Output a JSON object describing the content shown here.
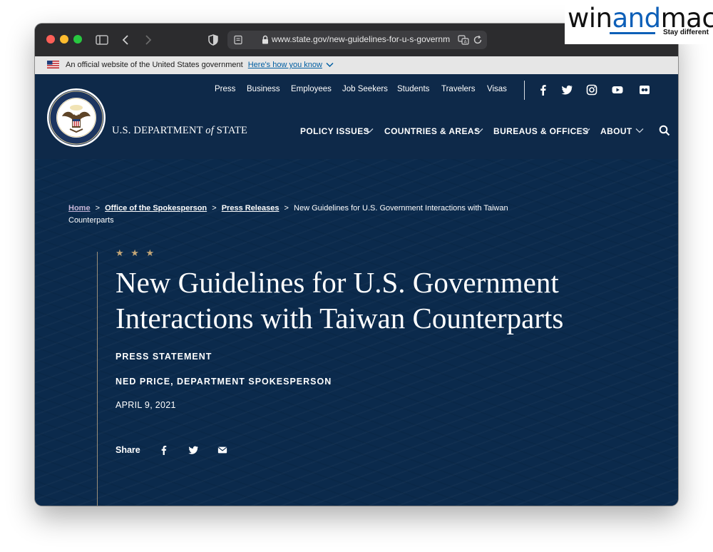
{
  "browser": {
    "url": "www.state.gov/new-guidelines-for-u-s-governm",
    "icons": [
      "sidebar-icon",
      "back-icon",
      "forward-icon",
      "shield-icon",
      "reader-icon",
      "lock-icon",
      "translate-icon",
      "reload-icon"
    ]
  },
  "gov_banner": {
    "text": "An official website of the United States government",
    "link": "Here's how you know"
  },
  "utility_nav": {
    "links": [
      "Press",
      "Business",
      "Employees",
      "Job Seekers",
      "Students",
      "Travelers",
      "Visas"
    ],
    "social": [
      "facebook-icon",
      "twitter-icon",
      "instagram-icon",
      "youtube-icon",
      "flickr-icon"
    ]
  },
  "header": {
    "dept_prefix": "U.S. DEPARTMENT",
    "dept_of": "of",
    "dept_suffix": "STATE",
    "nav": [
      "POLICY ISSUES",
      "COUNTRIES & AREAS",
      "BUREAUS & OFFICES",
      "ABOUT"
    ]
  },
  "breadcrumb": {
    "home": "Home",
    "spokesperson": "Office of the Spokesperson",
    "press": "Press Releases",
    "current": "New Guidelines for U.S. Government Interactions with Taiwan Counterparts"
  },
  "article": {
    "stars": "★ ★ ★",
    "title": "New Guidelines for U.S. Government Interactions with Taiwan Counterparts",
    "type": "PRESS STATEMENT",
    "author": "NED PRICE, DEPARTMENT SPOKESPERSON",
    "date": "APRIL 9, 2021",
    "share_label": "Share"
  },
  "watermark": {
    "win": "win",
    "and": "and",
    "mac": "mac",
    "tagline": "Stay different"
  },
  "colors": {
    "navy": "#0b2a4c",
    "header_navy": "#0e2949",
    "gold": "#c3a677",
    "link_blue": "#005ea2"
  }
}
